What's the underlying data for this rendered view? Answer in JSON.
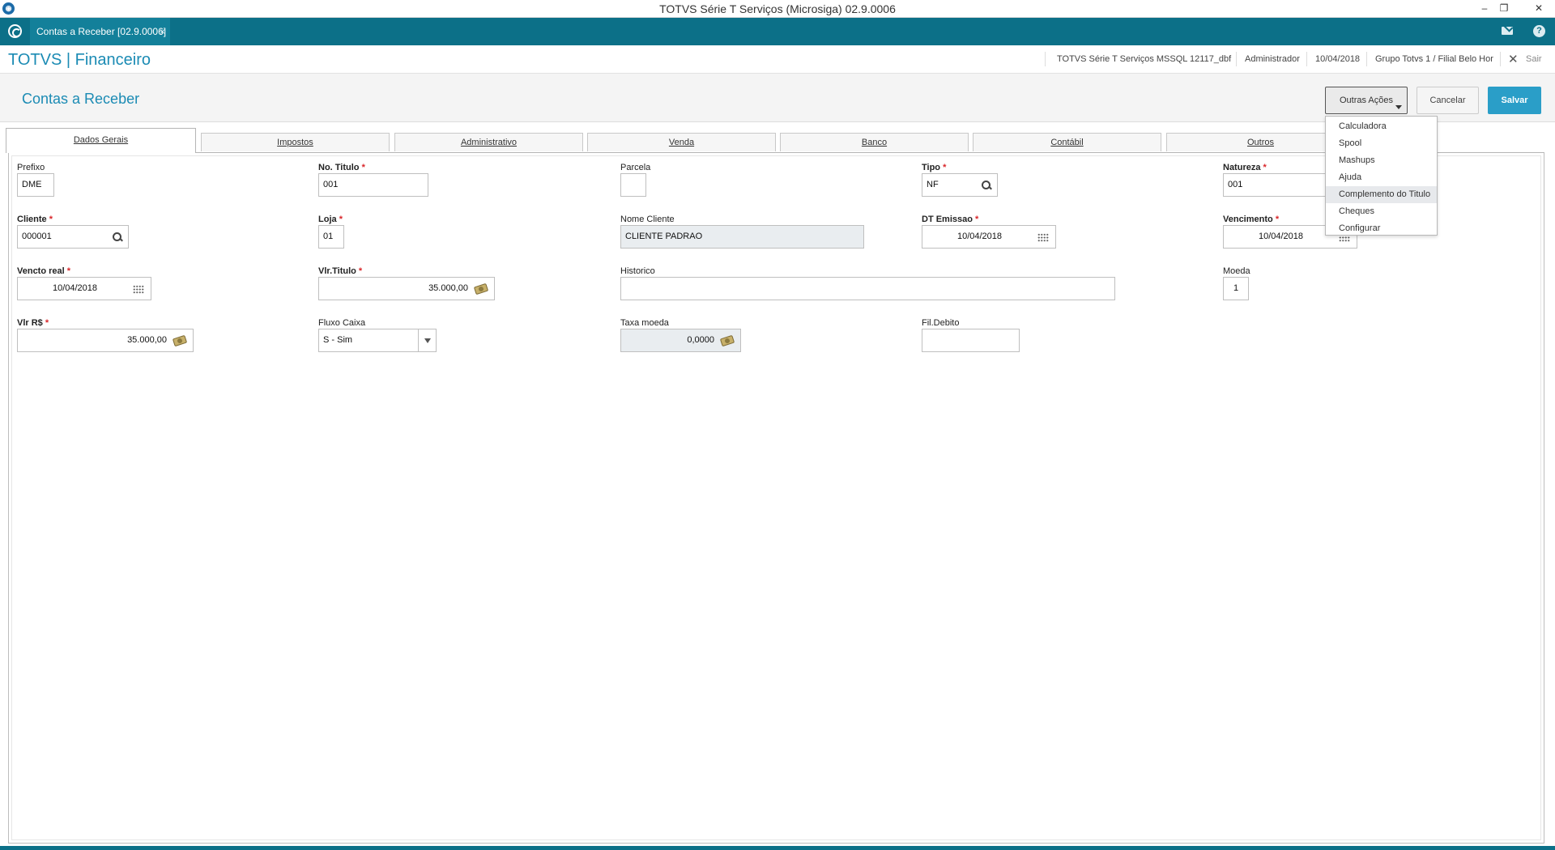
{
  "window": {
    "title": "TOTVS Série T Serviços (Microsiga) 02.9.0006"
  },
  "tabstrip": {
    "tab_label": "Contas a Receber [02.9.0006]",
    "close": "×"
  },
  "brand": {
    "title": "TOTVS | Financeiro",
    "environment": "TOTVS Série T Serviços MSSQL 12117_dbf",
    "user": "Administrador",
    "date": "10/04/2018",
    "company": "Grupo Totvs 1 / Filial Belo Hor",
    "exit": "Sair"
  },
  "header": {
    "title": "Contas a Receber",
    "other_actions": "Outras Ações",
    "cancel": "Cancelar",
    "save": "Salvar"
  },
  "tabs": [
    "Dados Gerais",
    "Impostos",
    "Administrativo",
    "Venda",
    "Banco",
    "Contábil",
    "Outros"
  ],
  "menu": {
    "items": [
      "Calculadora",
      "Spool",
      "Mashups",
      "Ajuda",
      "Complemento do Titulo",
      "Cheques",
      "Configurar"
    ],
    "highlighted": "Complemento do Titulo"
  },
  "form": {
    "prefixo": {
      "label": "Prefixo",
      "value": "DME"
    },
    "no_titulo": {
      "label": "No. Titulo",
      "value": "001"
    },
    "parcela": {
      "label": "Parcela",
      "value": ""
    },
    "tipo": {
      "label": "Tipo",
      "value": "NF"
    },
    "natureza": {
      "label": "Natureza",
      "value": "001"
    },
    "cliente": {
      "label": "Cliente",
      "value": "000001"
    },
    "loja": {
      "label": "Loja",
      "value": "01"
    },
    "nome_cliente": {
      "label": "Nome Cliente",
      "value": "CLIENTE PADRAO"
    },
    "dt_emissao": {
      "label": "DT Emissao",
      "value": "10/04/2018"
    },
    "vencimento": {
      "label": "Vencimento",
      "value": "10/04/2018"
    },
    "vencto_real": {
      "label": "Vencto real",
      "value": "10/04/2018"
    },
    "vlr_titulo": {
      "label": "Vlr.Titulo",
      "value": "35.000,00"
    },
    "historico": {
      "label": "Historico",
      "value": ""
    },
    "moeda": {
      "label": "Moeda",
      "value": "1"
    },
    "vlr_rs": {
      "label": "Vlr R$",
      "value": "35.000,00"
    },
    "fluxo_caixa": {
      "label": "Fluxo Caixa",
      "value": "S - Sim"
    },
    "taxa_moeda": {
      "label": "Taxa moeda",
      "value": "0,0000"
    },
    "fil_debito": {
      "label": "Fil.Debito",
      "value": ""
    },
    "required_mark": "*"
  }
}
